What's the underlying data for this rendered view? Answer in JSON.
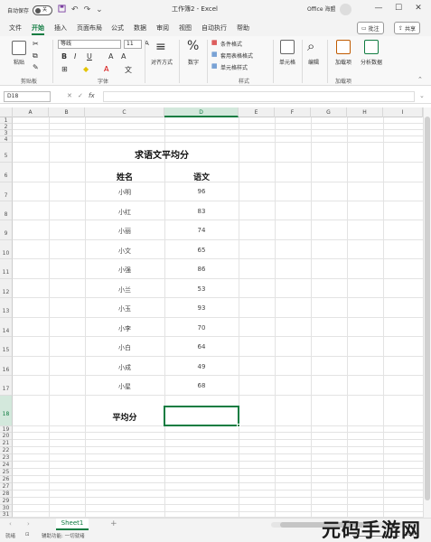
{
  "titlebar": {
    "autosave_label": "自动保存",
    "autosave_state": "关",
    "doc_title": "工作簿2 - Excel",
    "account": "Office 海盟"
  },
  "tabs": {
    "items": [
      "文件",
      "开始",
      "插入",
      "页面布局",
      "公式",
      "数据",
      "审阅",
      "视图",
      "自动执行",
      "帮助"
    ],
    "active": "开始",
    "comment_btn": "批注",
    "share_btn": "共享"
  },
  "ribbon": {
    "paste": "粘贴",
    "clipboard": "剪贴板",
    "font_name": "等线",
    "font_size": "11",
    "font_group": "字体",
    "align": "对齐方式",
    "number": "数字",
    "number_symbol": "%",
    "cond_format": "条件格式",
    "table_format": "套用表格格式",
    "cell_style": "单元格样式",
    "styles_group": "样式",
    "cells": "单元格",
    "editing": "编辑",
    "addins": "加载项",
    "addins_group": "加载项",
    "analyze": "分析数据"
  },
  "formula_bar": {
    "name_box": "D18",
    "fx": "fx"
  },
  "grid": {
    "columns": [
      "A",
      "B",
      "C",
      "D",
      "E",
      "F",
      "G",
      "H",
      "I"
    ],
    "selected_column": "D",
    "selected_row": "18",
    "title": "求语文平均分",
    "col_c_header": "姓名",
    "col_d_header": "语文",
    "rows": [
      {
        "row": "7",
        "name": "小明",
        "score": "96"
      },
      {
        "row": "8",
        "name": "小红",
        "score": "83"
      },
      {
        "row": "9",
        "name": "小丽",
        "score": "74"
      },
      {
        "row": "10",
        "name": "小文",
        "score": "65"
      },
      {
        "row": "11",
        "name": "小强",
        "score": "86"
      },
      {
        "row": "12",
        "name": "小兰",
        "score": "53"
      },
      {
        "row": "13",
        "name": "小玉",
        "score": "93"
      },
      {
        "row": "14",
        "name": "小李",
        "score": "70"
      },
      {
        "row": "15",
        "name": "小白",
        "score": "64"
      },
      {
        "row": "16",
        "name": "小成",
        "score": "49"
      },
      {
        "row": "17",
        "name": "小星",
        "score": "68"
      }
    ],
    "avg_label": "平均分"
  },
  "sheets": {
    "active": "Sheet1",
    "add": "+"
  },
  "statusbar": {
    "ready": "就绪",
    "accessibility": "辅助功能: 一切就绪",
    "zoom": "100%"
  },
  "watermark": {
    "text": "元码手游网"
  }
}
